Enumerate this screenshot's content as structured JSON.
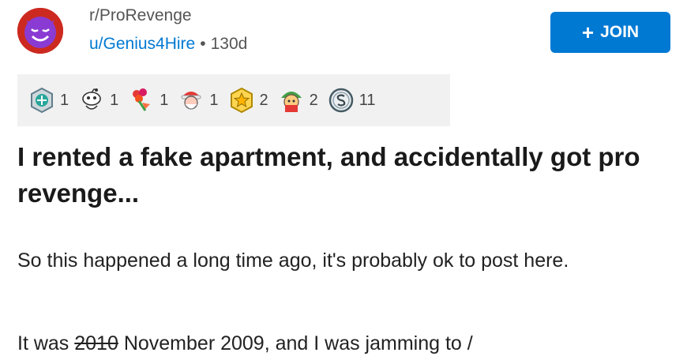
{
  "post": {
    "subreddit": "r/ProRevenge",
    "username": "u/Genius4Hire",
    "separator": "•",
    "age": "130d",
    "join_label": "JOIN",
    "join_icon": "plus-icon"
  },
  "awards": [
    {
      "icon": "helpful-award-icon",
      "count": "1"
    },
    {
      "icon": "snoo-award-icon",
      "count": "1"
    },
    {
      "icon": "bouquet-award-icon",
      "count": "1"
    },
    {
      "icon": "santa-award-icon",
      "count": "1"
    },
    {
      "icon": "gold-star-award-icon",
      "count": "2"
    },
    {
      "icon": "elf-award-icon",
      "count": "2"
    },
    {
      "icon": "silver-award-icon",
      "count": "11"
    }
  ],
  "content": {
    "title": "I rented a fake apartment, and accidentally got pro revenge...",
    "paragraph1": "So this happened a long time ago, it's probably ok to post here.",
    "p2_start": "It was ",
    "p2_strike": "2010",
    "p2_rest": " November 2009,  and I was jamming to /"
  },
  "colors": {
    "accent": "#0079d3",
    "avatar_bg": "#cc2a20",
    "avatar_face": "#8a3bd3",
    "awards_bg": "#f1f1f1"
  }
}
